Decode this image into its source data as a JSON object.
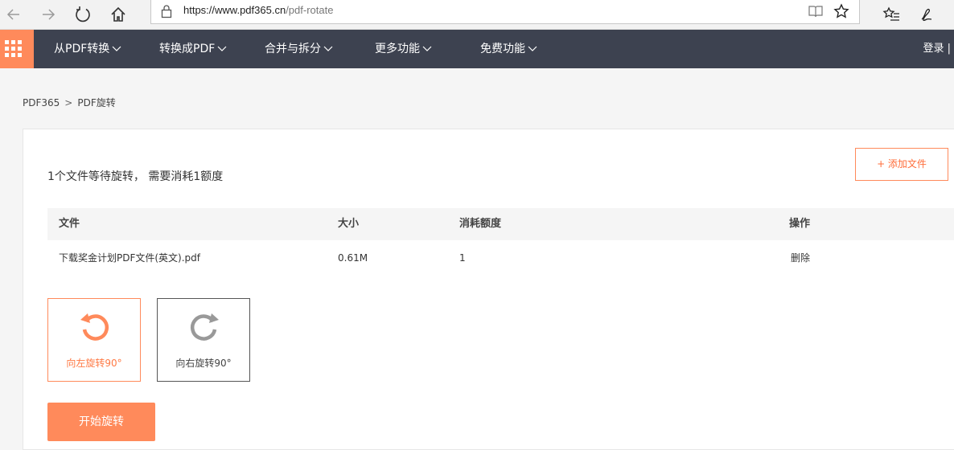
{
  "browser": {
    "url_host": "https://www.pdf365.cn",
    "url_path": "/pdf-rotate"
  },
  "nav": {
    "items": [
      {
        "label": "从PDF转换"
      },
      {
        "label": "转换成PDF"
      },
      {
        "label": "合并与拆分"
      },
      {
        "label": "更多功能"
      },
      {
        "label": "免费功能"
      }
    ],
    "login": "登录 |"
  },
  "breadcrumb": {
    "home": "PDF365",
    "separator": ">",
    "current": "PDF旋转"
  },
  "panel": {
    "summary": "1个文件等待旋转， 需要消耗1额度",
    "add_file": "+ 添加文件",
    "table": {
      "headers": {
        "file": "文件",
        "size": "大小",
        "cost": "消耗额度",
        "action": "操作"
      },
      "rows": [
        {
          "file": "下载奖金计划PDF文件(英文).pdf",
          "size": "0.61M",
          "cost": "1",
          "action": "删除"
        }
      ]
    },
    "rotate_left": "向左旋转90°",
    "rotate_right": "向右旋转90°",
    "start": "开始旋转"
  },
  "colors": {
    "accent": "#ff8a5b",
    "nav_bg": "#3d4250"
  }
}
